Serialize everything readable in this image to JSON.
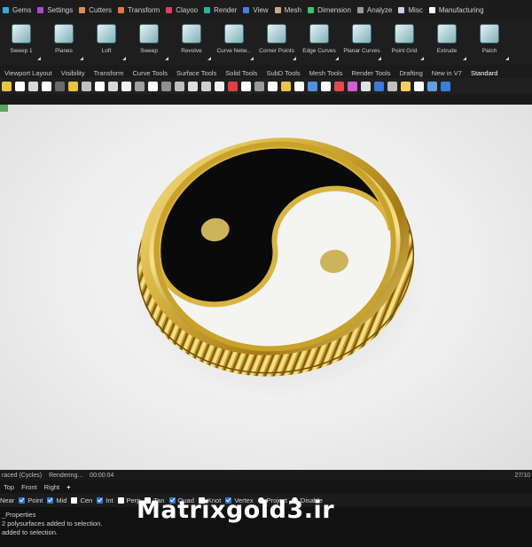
{
  "categories": [
    {
      "label": "Gems",
      "color": "#3aa7d9"
    },
    {
      "label": "Settings",
      "color": "#b04ac7"
    },
    {
      "label": "Cutters",
      "color": "#e08a5a"
    },
    {
      "label": "Transform",
      "color": "#e07a3a"
    },
    {
      "label": "Clayoo",
      "color": "#e0405a"
    },
    {
      "label": "Render",
      "color": "#2fb0a0"
    },
    {
      "label": "View",
      "color": "#4a7de0"
    },
    {
      "label": "Mesh",
      "color": "#c8a88a"
    },
    {
      "label": "Dimension",
      "color": "#3ac46a"
    },
    {
      "label": "Analyze",
      "color": "#9a9a9a"
    },
    {
      "label": "Misc",
      "color": "#d8c8f0"
    },
    {
      "label": "Manufacturing",
      "color": "#ffffff"
    }
  ],
  "tools": [
    {
      "label": "Sweep 1"
    },
    {
      "label": "Planes"
    },
    {
      "label": "Loft"
    },
    {
      "label": "Sweep"
    },
    {
      "label": "Revolve"
    },
    {
      "label": "Curve Netw..."
    },
    {
      "label": "Corner Points"
    },
    {
      "label": "Edge Curves"
    },
    {
      "label": "Planar Curves"
    },
    {
      "label": "Point Grid"
    },
    {
      "label": "Extrude"
    },
    {
      "label": "Patch"
    }
  ],
  "subtabs": [
    "Viewport Layout",
    "Visibility",
    "Transform",
    "Curve Tools",
    "Surface Tools",
    "Solid Tools",
    "SubD Tools",
    "Mesh Tools",
    "Render Tools",
    "Drafting",
    "New in V7",
    "Standard"
  ],
  "small_icon_colors": [
    "#e8c440",
    "#ffffff",
    "#d8d8d8",
    "#ffffff",
    "#6a6a6a",
    "#e8c440",
    "#c0c0c0",
    "#ffffff",
    "#d8d8d8",
    "#f0f0f0",
    "#a0a0a0",
    "#ffffff",
    "#909090",
    "#c0c0c0",
    "#e0e0e0",
    "#d0d0d0",
    "#f0f0f0",
    "#e04040",
    "#ffffff",
    "#9a9a9a",
    "#ffffff",
    "#e8c440",
    "#ffffff",
    "#5090e0",
    "#ffffff",
    "#e04a4a",
    "#d060d0",
    "#e0e0e0",
    "#3a7ad8",
    "#c0c0c0",
    "#f0d060",
    "#ffffff",
    "#60a0e0",
    "#3a80d8"
  ],
  "render_status": {
    "engine": "raced (Cycles)",
    "state": "Rendering...",
    "time": "00:00:04",
    "progress": "27/10"
  },
  "view_tabs": [
    "Top",
    "Front",
    "Right",
    "+"
  ],
  "osnaps": [
    {
      "label": "Near",
      "kind": "none"
    },
    {
      "label": "Point",
      "kind": "on"
    },
    {
      "label": "Mid",
      "kind": "on"
    },
    {
      "label": "Cen",
      "kind": "off"
    },
    {
      "label": "Int",
      "kind": "on"
    },
    {
      "label": "Perp",
      "kind": "off"
    },
    {
      "label": "Tan",
      "kind": "off"
    },
    {
      "label": "Quad",
      "kind": "on"
    },
    {
      "label": "Knot",
      "kind": "off"
    },
    {
      "label": "Vertex",
      "kind": "on"
    },
    {
      "label": "Project",
      "kind": "radio"
    },
    {
      "label": "Disable",
      "kind": "radio"
    }
  ],
  "command_history": [
    "_Properties",
    "2 polysurfaces added to selection.",
    "added to selection."
  ],
  "watermark": "Matrixgold3.ir",
  "colors": {
    "gold": "#c9a22a",
    "gold_light": "#f2dc7a",
    "gold_dark": "#7a5a10",
    "enamel_black": "#0a0a0a",
    "enamel_white": "#f4f4f2",
    "viewport_bg": "#ededed"
  }
}
